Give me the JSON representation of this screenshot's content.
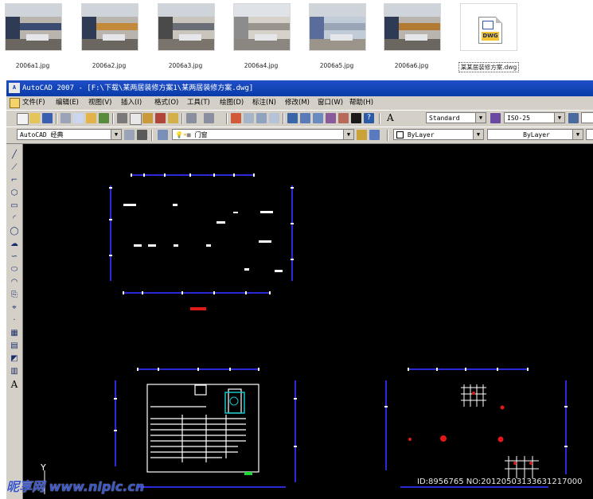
{
  "thumbnails": [
    {
      "caption": "2006a1.jpg",
      "kind": "image"
    },
    {
      "caption": "2006a2.jpg",
      "kind": "image"
    },
    {
      "caption": "2006a3.jpg",
      "kind": "image"
    },
    {
      "caption": "2006a4.jpg",
      "kind": "image"
    },
    {
      "caption": "2006a5.jpg",
      "kind": "image"
    },
    {
      "caption": "2006a6.jpg",
      "kind": "image"
    },
    {
      "caption": "某某居装修方案.dwg",
      "kind": "dwg",
      "icon_label": "DWG"
    }
  ],
  "window": {
    "app_icon": "A",
    "title": "AutoCAD 2007 - [F:\\下载\\某两居装修方案1\\某两居装修方案.dwg]"
  },
  "menu": [
    "文件(F)",
    "编辑(E)",
    "视图(V)",
    "插入(I)",
    "格式(O)",
    "工具(T)",
    "绘图(D)",
    "标注(N)",
    "修改(M)",
    "窗口(W)",
    "帮助(H)"
  ],
  "toolbar": {
    "text_style": "Standard",
    "dim_style": "ISO-25",
    "workspace": "AutoCAD 经典",
    "layer": "门窗",
    "color": "ByLayer",
    "linetype": "ByLayer",
    "text_style_icon_label": "A"
  },
  "left_tools": [
    "line-icon",
    "construction-line-icon",
    "polyline-icon",
    "polygon-icon",
    "rectangle-icon",
    "arc-icon",
    "circle-icon",
    "revision-cloud-icon",
    "spline-icon",
    "ellipse-icon",
    "ellipse-arc-icon",
    "insert-block-icon",
    "make-block-icon",
    "point-icon",
    "hatch-icon",
    "gradient-icon",
    "region-icon",
    "table-icon",
    "multiline-text-icon"
  ],
  "multiline_text_label": "A",
  "ucs_label": "Y",
  "watermark": {
    "site": "昵享网 www.nipic.cn",
    "id": "ID:8956765 NO:20120503133631217000"
  },
  "colors": {
    "titlebar": "#0a3aa8",
    "canvas": "#000000",
    "dim_blue": "#2a2ad8",
    "highlight_red": "#e01818"
  }
}
